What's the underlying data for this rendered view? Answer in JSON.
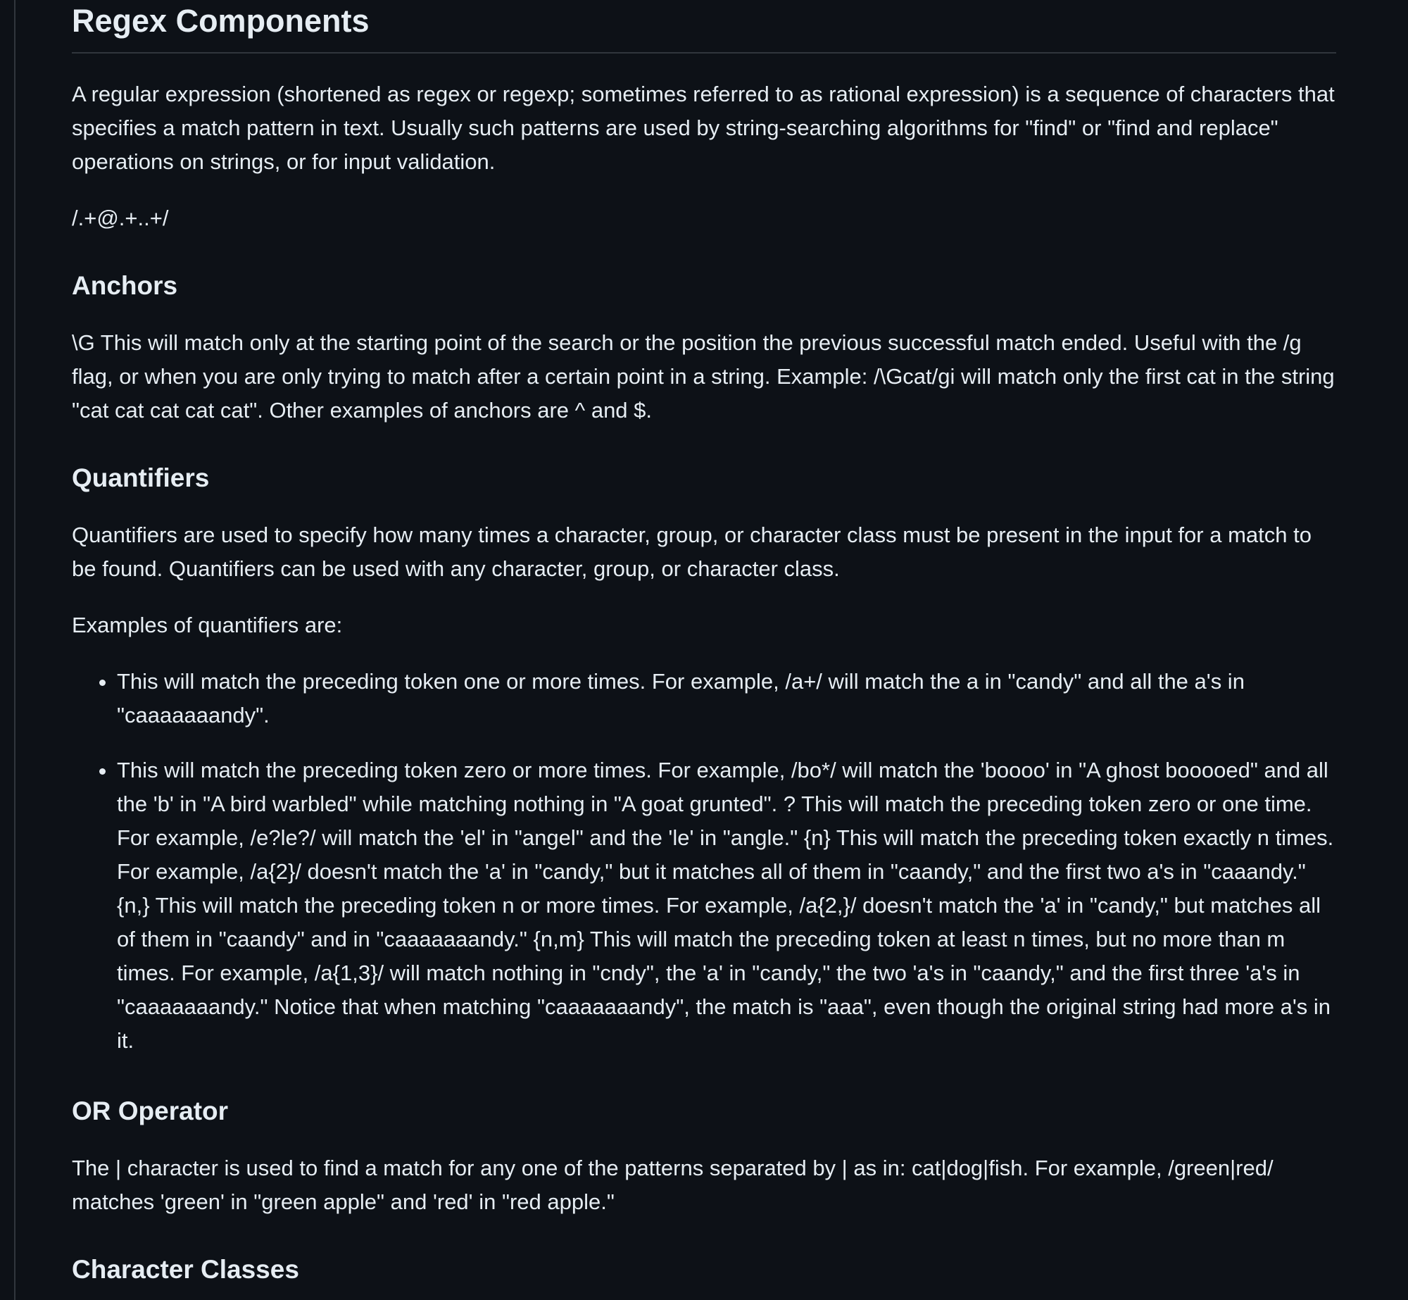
{
  "title": "Regex Components",
  "intro": "A regular expression (shortened as regex or regexp; sometimes referred to as rational expression) is a sequence of characters that specifies a match pattern in text. Usually such patterns are used by string-searching algorithms for \"find\" or \"find and replace\" operations on strings, or for input validation.",
  "example_pattern": "/.+@.+..+/",
  "sections": {
    "anchors": {
      "heading": "Anchors",
      "body": "\\G This will match only at the starting point of the search or the position the previous successful match ended. Useful with the /g flag, or when you are only trying to match after a certain point in a string. Example: /\\Gcat/gi will match only the first cat in the string \"cat cat cat cat cat\". Other examples of anchors are ^ and $."
    },
    "quantifiers": {
      "heading": "Quantifiers",
      "body": "Quantifiers are used to specify how many times a character, group, or character class must be present in the input for a match to be found. Quantifiers can be used with any character, group, or character class.",
      "examples_intro": "Examples of quantifiers are:",
      "items": [
        "This will match the preceding token one or more times. For example, /a+/ will match the a in \"candy\" and all the a's in \"caaaaaaandy\".",
        "This will match the preceding token zero or more times. For example, /bo*/ will match the 'boooo' in \"A ghost booooed\" and all the 'b' in \"A bird warbled\" while matching nothing in \"A goat grunted\". ? This will match the preceding token zero or one time. For example, /e?le?/ will match the 'el' in \"angel\" and the 'le' in \"angle.\" {n} This will match the preceding token exactly n times. For example, /a{2}/ doesn't match the 'a' in \"candy,\" but it matches all of them in \"caandy,\" and the first two a's in \"caaandy.\" {n,} This will match the preceding token n or more times. For example, /a{2,}/ doesn't match the 'a' in \"candy,\" but matches all of them in \"caandy\" and in \"caaaaaaandy.\" {n,m} This will match the preceding token at least n times, but no more than m times. For example, /a{1,3}/ will match nothing in \"cndy\", the 'a' in \"candy,\" the two 'a's in \"caandy,\" and the first three 'a's in \"caaaaaaandy.\" Notice that when matching \"caaaaaaandy\", the match is \"aaa\", even though the original string had more a's in it."
      ]
    },
    "or_operator": {
      "heading": "OR Operator",
      "body": "The | character is used to find a match for any one of the patterns separated by | as in: cat|dog|fish. For example, /green|red/ matches 'green' in \"green apple\" and 'red' in \"red apple.\""
    },
    "character_classes": {
      "heading": "Character Classes"
    }
  }
}
